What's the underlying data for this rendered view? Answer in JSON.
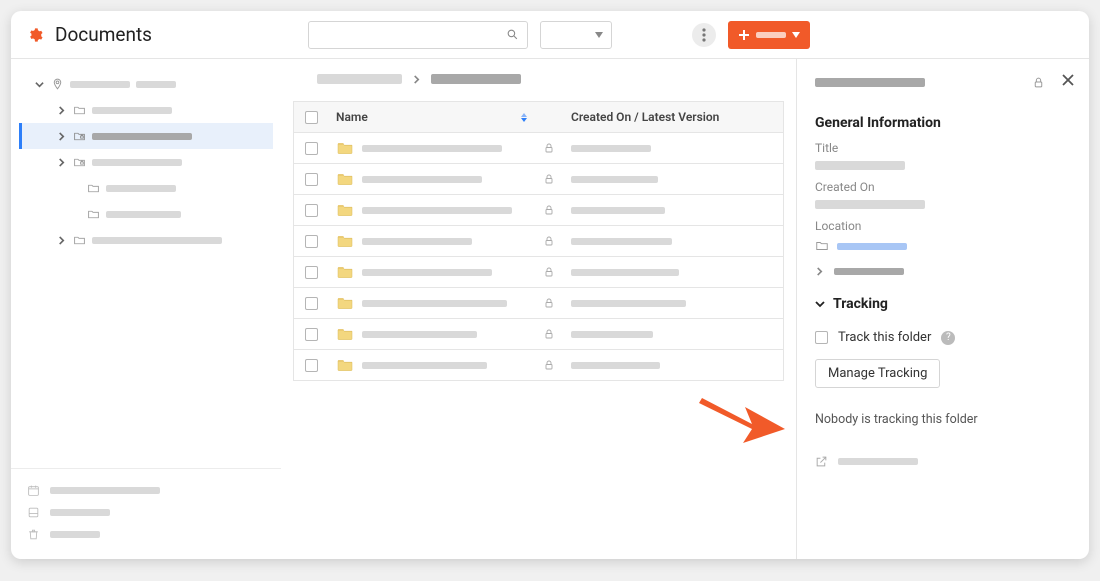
{
  "header": {
    "title": "Documents",
    "search_placeholder": ""
  },
  "table": {
    "col_name": "Name",
    "col_created": "Created On / Latest Version",
    "rows": 8
  },
  "details": {
    "general_title": "General Information",
    "label_title": "Title",
    "label_created": "Created On",
    "label_location": "Location",
    "tracking_title": "Tracking",
    "track_label": "Track this folder",
    "manage_label": "Manage Tracking",
    "nobody_text": "Nobody is tracking this folder"
  }
}
